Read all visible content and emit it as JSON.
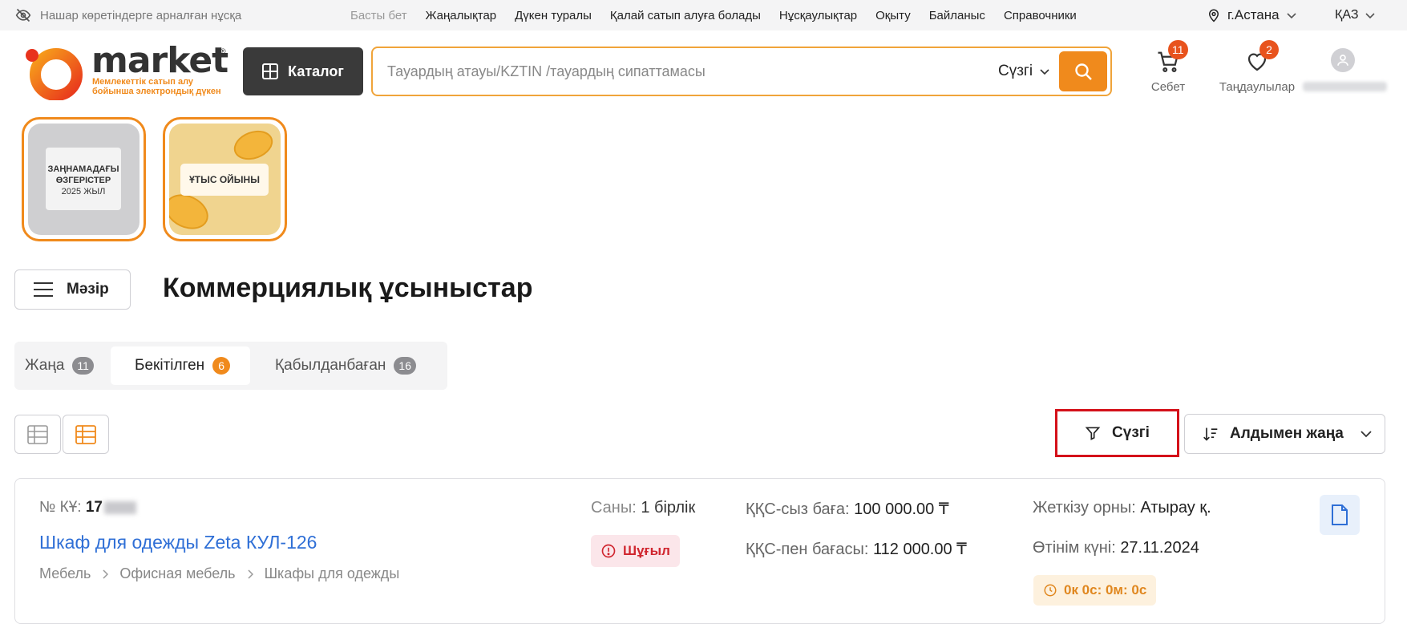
{
  "topbar": {
    "accessibility_label": "Нашар көретіндерге арналған нұсқа",
    "nav": [
      "Басты бет",
      "Жаңалықтар",
      "Дүкен туралы",
      "Қалай сатып алуға болады",
      "Нұсқаулықтар",
      "Оқыту",
      "Байланыс",
      "Справочники"
    ],
    "city": "г.Астана",
    "language": "ҚАЗ"
  },
  "header": {
    "logo_name": "market",
    "logo_reg": "®",
    "logo_tagline_1": "Мемлекеттік сатып алу",
    "logo_tagline_2": "бойынша электрондық дүкен",
    "catalog_label": "Каталог",
    "search_placeholder": "Тауардың атауы/KZTIN /тауардың сипаттамасы",
    "search_filter_label": "Сүзгі",
    "cart_label": "Себет",
    "cart_count": "11",
    "favorites_label": "Таңдаулылар",
    "favorites_count": "2"
  },
  "stories": [
    {
      "line1": "ЗАҢНАМАДАҒЫ",
      "line2": "ӨЗГЕРІСТЕР",
      "line3": "2025 ЖЫЛ"
    },
    {
      "line1": "ҰТЫС ОЙЫНЫ"
    }
  ],
  "page": {
    "menu_label": "Мәзір",
    "title": "Коммерциялық ұсыныстар"
  },
  "tabs": [
    {
      "label": "Жаңа",
      "count": "11",
      "active": false
    },
    {
      "label": "Бекітілген",
      "count": "6",
      "active": true
    },
    {
      "label": "Қабылданбаған",
      "count": "16",
      "active": false
    }
  ],
  "toolbar": {
    "filter_label": "Сүзгі",
    "sort_label": "Алдымен жаңа"
  },
  "offer": {
    "number_label": "№ КҰ:",
    "number_visible": "17",
    "product": "Шкаф для одежды Zeta КУЛ-126",
    "breadcrumbs": [
      "Мебель",
      "Офисная мебель",
      "Шкафы для одежды"
    ],
    "qty_label": "Саны:",
    "qty_value": "1 бірлік",
    "urgent_label": "Шұғыл",
    "price_no_vat_label": "ҚҚС-сыз баға:",
    "price_no_vat": "100 000.00 ₸",
    "price_vat_label": "ҚҚС-пен бағасы:",
    "price_vat": "112 000.00 ₸",
    "delivery_label": "Жеткізу орны:",
    "delivery_value": "Атырау қ.",
    "date_label": "Өтінім күні:",
    "date_value": "27.11.2024",
    "timer": "0к 0с: 0м: 0с"
  },
  "colors": {
    "accent": "#f08a1c",
    "dark_button": "#3a3a3a",
    "link": "#2f6fd6",
    "urgent": "#d0262f",
    "highlight_border": "#d4111a"
  }
}
